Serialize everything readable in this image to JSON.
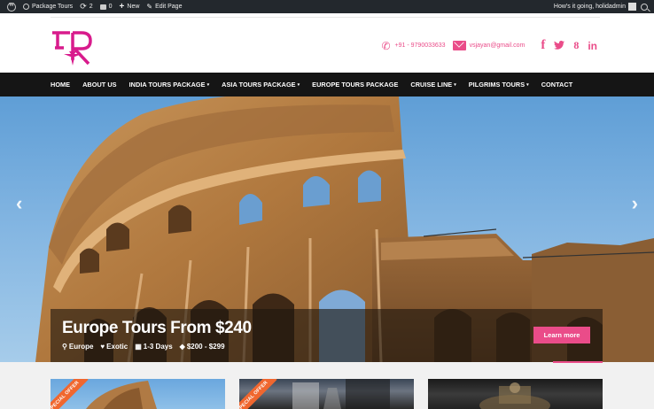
{
  "adminbar": {
    "site_name": "Package Tours",
    "updates": "2",
    "comments": "0",
    "new_label": "New",
    "edit_label": "Edit Page",
    "greeting": "How's it going, holidadmin"
  },
  "header": {
    "logo_text": "TR",
    "phone": "+91 - 9790033633",
    "email": "vsjayan@gmail.com",
    "social": {
      "facebook": "f",
      "twitter": "🐦",
      "google": "8",
      "linkedin": "in"
    }
  },
  "nav": {
    "items": [
      {
        "label": "HOME",
        "caret": ""
      },
      {
        "label": "ABOUT US",
        "caret": ""
      },
      {
        "label": "INDIA TOURS PACKAGE",
        "caret": "▾"
      },
      {
        "label": "ASIA TOURS PACKAGE",
        "caret": "▾"
      },
      {
        "label": "EUROPE TOURS PACKAGE",
        "caret": ""
      },
      {
        "label": "CRUISE LINE",
        "caret": "▾"
      },
      {
        "label": "PILGRIMS TOURS",
        "caret": "▾"
      },
      {
        "label": "CONTACT",
        "caret": ""
      }
    ]
  },
  "slider": {
    "prev_icon": "‹",
    "next_icon": "›",
    "title": "Europe Tours From $240",
    "location": "Europe",
    "category": "Exotic",
    "duration": "1-3 Days",
    "price": "$200 - $299",
    "button_label": "Learn more"
  },
  "cards": [
    {
      "ribbon": "SPECIAL OFFER"
    },
    {
      "ribbon": "SPECIAL OFFER"
    },
    {
      "ribbon": ""
    }
  ],
  "colors": {
    "accent": "#ea4c89",
    "nav_bg": "#151515",
    "adminbar_bg": "#23282d",
    "ribbon": "#f0672f"
  }
}
